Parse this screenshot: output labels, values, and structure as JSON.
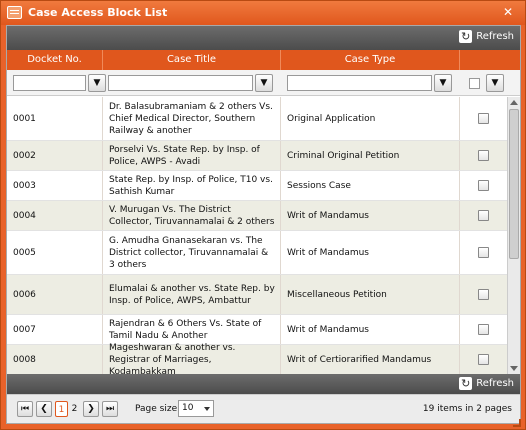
{
  "window": {
    "title": "Case Access Block List",
    "close": "✕"
  },
  "toolbar": {
    "refresh_label": "Refresh",
    "refresh_icon": "↻"
  },
  "columns": [
    "Docket No.",
    "Case Title",
    "Case Type",
    ""
  ],
  "filter": {
    "btn_glyph": "▼"
  },
  "rows": [
    {
      "docket": "0001",
      "title": "Dr. Balasubramaniam & 2 others Vs. Chief Medical Director, Southern Railway & another",
      "type": "Original Application"
    },
    {
      "docket": "0002",
      "title": "Porselvi Vs. State Rep. by Insp. of Police, AWPS - Avadi",
      "type": "Criminal Original Petition"
    },
    {
      "docket": "0003",
      "title": "State Rep. by Insp. of Police, T10 vs. Sathish Kumar",
      "type": "Sessions Case"
    },
    {
      "docket": "0004",
      "title": "V. Murugan Vs. The District Collector, Tiruvannamalai & 2 others",
      "type": "Writ of Mandamus"
    },
    {
      "docket": "0005",
      "title": "G. Amudha Gnanasekaran vs. The District collector, Tiruvannamalai & 3 others",
      "type": "Writ of Mandamus"
    },
    {
      "docket": "0006",
      "title": "Elumalai & another vs. State Rep. by Insp. of Police, AWPS, Ambattur",
      "type": "Miscellaneous Petition"
    },
    {
      "docket": "0007",
      "title": "Rajendran & 6 Others Vs. State of Tamil Nadu & Another",
      "type": "Writ of Mandamus"
    },
    {
      "docket": "0008",
      "title": "Mageshwaran & another vs. Registrar of Marriages, Kodambakkam",
      "type": "Writ of Certiorarified Mandamus"
    }
  ],
  "pager": {
    "first": "⏮",
    "prev": "❮",
    "next": "❯",
    "last": "⏭",
    "pages": [
      "1",
      "2"
    ],
    "page_size_label": "Page size:",
    "page_size": "10",
    "items_count": "19",
    "items_mid": "items in",
    "pages_count": "2",
    "pages_word": "pages"
  },
  "colors": {
    "accent": "#e0571d",
    "toolbar": "#5a5a5a",
    "alt_row": "#edede3"
  }
}
